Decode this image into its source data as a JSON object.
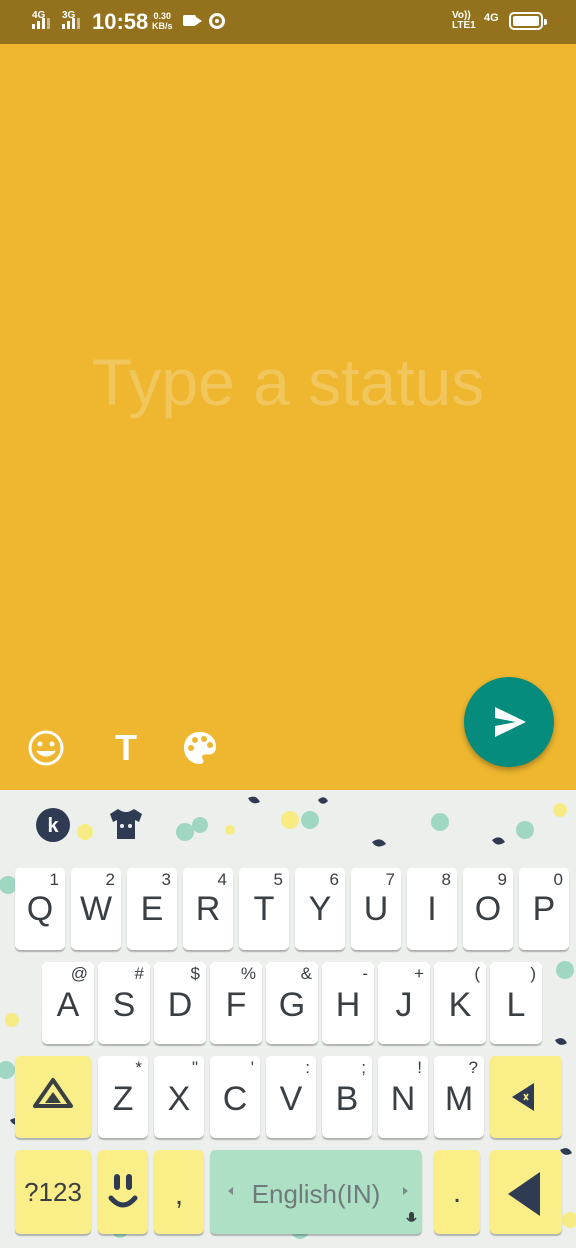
{
  "status_bar": {
    "sim1_type": "4G",
    "sim2_type": "3G",
    "time": "10:58",
    "speed_value": "0.30",
    "speed_unit": "KB/s",
    "volte_top": "Vo))",
    "volte_bottom": "LTE1",
    "network": "4G"
  },
  "composer": {
    "placeholder": "Type a status",
    "text_tool_label": "T",
    "icons": {
      "emoji": "smiley-icon",
      "text": "text-format-icon",
      "palette": "palette-icon",
      "send": "send-arrow-icon"
    }
  },
  "keyboard": {
    "icons": {
      "logo": "kika-logo-icon",
      "theme": "tshirt-theme-icon"
    },
    "row1": [
      {
        "key": "Q",
        "hint": "1"
      },
      {
        "key": "W",
        "hint": "2"
      },
      {
        "key": "E",
        "hint": "3"
      },
      {
        "key": "R",
        "hint": "4"
      },
      {
        "key": "T",
        "hint": "5"
      },
      {
        "key": "Y",
        "hint": "6"
      },
      {
        "key": "U",
        "hint": "7"
      },
      {
        "key": "I",
        "hint": "8"
      },
      {
        "key": "O",
        "hint": "9"
      },
      {
        "key": "P",
        "hint": "0"
      }
    ],
    "row2": [
      {
        "key": "A",
        "hint": "@"
      },
      {
        "key": "S",
        "hint": "#"
      },
      {
        "key": "D",
        "hint": "$"
      },
      {
        "key": "F",
        "hint": "%"
      },
      {
        "key": "G",
        "hint": "&"
      },
      {
        "key": "H",
        "hint": "-"
      },
      {
        "key": "J",
        "hint": "+"
      },
      {
        "key": "K",
        "hint": "("
      },
      {
        "key": "L",
        "hint": ")"
      }
    ],
    "row3": [
      {
        "key": "Z",
        "hint": "*"
      },
      {
        "key": "X",
        "hint": "\""
      },
      {
        "key": "C",
        "hint": "'"
      },
      {
        "key": "V",
        "hint": ":"
      },
      {
        "key": "B",
        "hint": ";"
      },
      {
        "key": "N",
        "hint": "!"
      },
      {
        "key": "M",
        "hint": "?"
      }
    ],
    "symbols_label": "?123",
    "comma_label": ",",
    "space_label": "English(IN)",
    "period_label": ".",
    "colors": {
      "yellow_key": "#f9ee87",
      "space_key": "#aee0c5",
      "accent": "#058c7c",
      "background": "#eeb72f"
    }
  }
}
